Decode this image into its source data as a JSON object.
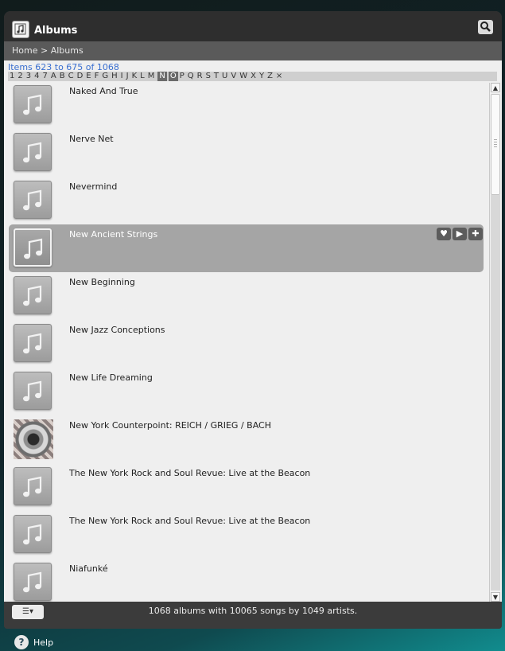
{
  "window": {
    "title": "Albums"
  },
  "breadcrumb": "Home > Albums",
  "items_count": "Items 623 to 675 of 1068",
  "alpha_index": {
    "letters": [
      "1",
      "2",
      "3",
      "4",
      "7",
      "A",
      "B",
      "C",
      "D",
      "E",
      "F",
      "G",
      "H",
      "I",
      "J",
      "K",
      "L",
      "M",
      "N",
      "O",
      "P",
      "Q",
      "R",
      "S",
      "T",
      "U",
      "V",
      "W",
      "X",
      "Y",
      "Z",
      "×"
    ],
    "active": [
      "N",
      "O"
    ]
  },
  "albums": [
    {
      "title": "Naked And True",
      "art": false
    },
    {
      "title": "Nerve Net",
      "art": false
    },
    {
      "title": "Nevermind",
      "art": false
    },
    {
      "title": "New Ancient Strings",
      "art": false,
      "selected": true
    },
    {
      "title": "New Beginning",
      "art": false
    },
    {
      "title": "New Jazz Conceptions",
      "art": false
    },
    {
      "title": "New Life Dreaming",
      "art": false
    },
    {
      "title": "New York Counterpoint: REICH / GRIEG / BACH",
      "art": true
    },
    {
      "title": "The New York Rock and Soul Revue: Live at the Beacon",
      "art": false
    },
    {
      "title": "The New York Rock and Soul Revue: Live at the Beacon",
      "art": false
    },
    {
      "title": "Niafunké",
      "art": false
    }
  ],
  "row_actions": {
    "favorite_icon": "heart-icon",
    "play_icon": "play-icon",
    "add_icon": "plus-icon"
  },
  "footer": {
    "status": "1068 albums with 10065 songs by 1049 artists.",
    "view_icon": "list-view-icon"
  },
  "help": {
    "label": "Help"
  }
}
